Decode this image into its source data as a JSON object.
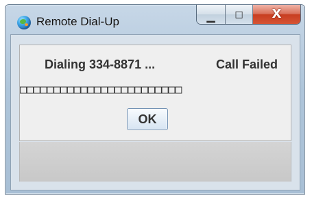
{
  "window": {
    "title": "Remote Dial-Up",
    "title_icon": "globe-icon",
    "controls": {
      "minimize_glyph": "▁",
      "maximize_glyph": "□",
      "close_glyph": "X"
    }
  },
  "dialog": {
    "dialing_text": "Dialing 334-8871 ...",
    "status_text": "Call Failed",
    "progress_glyphs": "□□□□□□□□□□□□□□□□□□□□□□□□",
    "ok_label": "OK"
  },
  "colors": {
    "title_bar": "#aec5da",
    "close_button": "#c73d20",
    "dialog_background": "#efefef"
  }
}
